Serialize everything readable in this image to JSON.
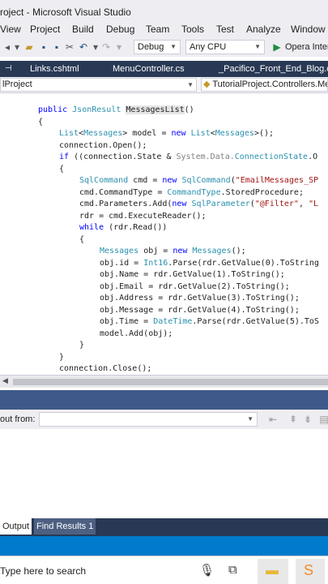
{
  "window": {
    "title": "roject - Microsoft Visual Studio"
  },
  "menu": [
    "View",
    "Project",
    "Build",
    "Debug",
    "Team",
    "Tools",
    "Test",
    "Analyze",
    "Window"
  ],
  "toolbar": {
    "config": "Debug",
    "platform": "Any CPU",
    "run_label": "Opera Inter"
  },
  "tabs": [
    "Links.cshtml",
    "MenuController.cs",
    "_Pacifico_Front_End_Blog.csh"
  ],
  "navbar": {
    "project": "lProject",
    "class": "TutorialProject.Controllers.Me"
  },
  "code": [
    "public JsonResult MessagesList()",
    "{",
    "List<Messages> model = new List<Messages>();",
    "connection.Open();",
    "if ((connection.State & System.Data.ConnectionState.O",
    "{",
    "SqlCommand cmd = new SqlCommand(\"EmailMessages_SP",
    "cmd.CommandType = CommandType.StoredProcedure;",
    "cmd.Parameters.Add(new SqlParameter(\"@Filter\", \"L",
    "rdr = cmd.ExecuteReader();",
    "while (rdr.Read())",
    "{",
    "Messages obj = new Messages();",
    "obj.id = Int16.Parse(rdr.GetValue(0).ToString",
    "obj.Name = rdr.GetValue(1).ToString();",
    "obj.Email = rdr.GetValue(2).ToString();",
    "obj.Address = rdr.GetValue(3).ToString();",
    "obj.Message = rdr.GetValue(4).ToString();",
    "obj.Time = DateTime.Parse(rdr.GetValue(5).ToS",
    "model.Add(obj);",
    "}",
    "}",
    "connection.Close();"
  ],
  "output": {
    "show_from_label": "out from:",
    "show_from_value": ""
  },
  "bottom_tabs": [
    "Output",
    "Find Results 1"
  ],
  "taskbar": {
    "search_placeholder": "Type here to search"
  },
  "colors": {
    "tabstrip": "#293955",
    "status": "#007acc",
    "keyword": "#0000ff",
    "type": "#2b91af",
    "string": "#a31515"
  }
}
